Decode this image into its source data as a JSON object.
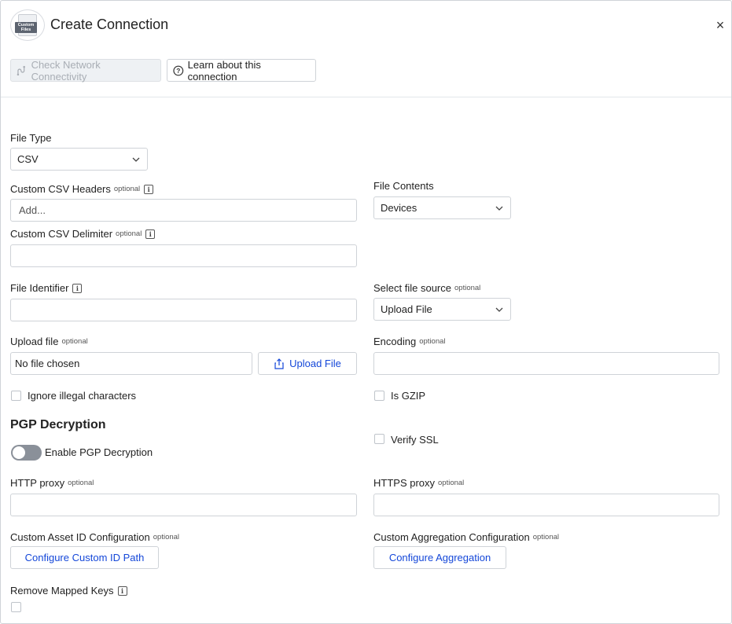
{
  "header": {
    "logo_text": "Custom Files",
    "title": "Create Connection",
    "close_icon": "close-icon"
  },
  "toolbar": {
    "check_network": "Check Network Connectivity",
    "learn_about": "Learn about this connection"
  },
  "labels": {
    "optional": "optional",
    "file_type": "File Type",
    "custom_csv_headers": "Custom CSV Headers",
    "file_contents": "File Contents",
    "custom_csv_delimiter": "Custom CSV Delimiter",
    "file_identifier": "File Identifier",
    "select_file_source": "Select file source",
    "upload_file": "Upload file",
    "encoding": "Encoding",
    "ignore_illegal": "Ignore illegal characters",
    "is_gzip": "Is GZIP",
    "pgp_section": "PGP Decryption",
    "verify_ssl": "Verify SSL",
    "enable_pgp": "Enable PGP Decryption",
    "http_proxy": "HTTP proxy",
    "https_proxy": "HTTPS proxy",
    "custom_asset_id": "Custom Asset ID Configuration",
    "custom_aggregation": "Custom Aggregation Configuration",
    "remove_mapped_keys": "Remove Mapped Keys"
  },
  "fields": {
    "file_type_value": "CSV",
    "custom_csv_headers_placeholder": "Add...",
    "file_contents_value": "Devices",
    "custom_csv_delimiter_value": "",
    "file_identifier_value": "",
    "file_source_value": "Upload File",
    "upload_file_value": "No file chosen",
    "upload_button": "Upload File",
    "encoding_value": "",
    "http_proxy_value": "",
    "https_proxy_value": "",
    "configure_custom_id": "Configure Custom ID Path",
    "configure_aggregation": "Configure Aggregation"
  },
  "state": {
    "ignore_illegal_checked": false,
    "is_gzip_checked": false,
    "verify_ssl_checked": false,
    "enable_pgp_on": false,
    "remove_mapped_keys_checked": false
  },
  "colors": {
    "accent_blue": "#1447d9",
    "border": "#cfd3d8",
    "toggle_off": "#8a9099"
  }
}
